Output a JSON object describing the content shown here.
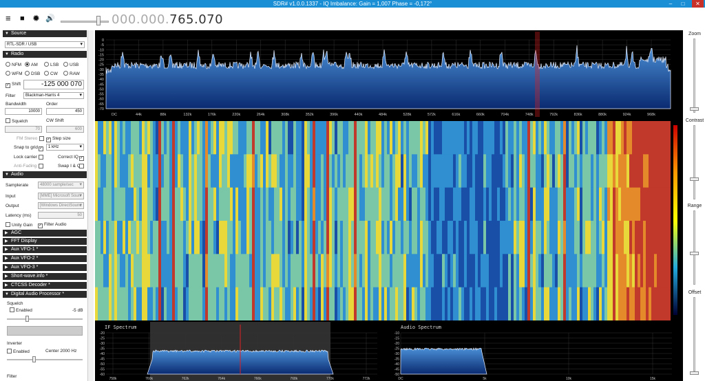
{
  "window": {
    "title": "SDR# v1.0.0.1337 - IQ Imbalance: Gain = 1,007 Phase = -0,172°",
    "minimize": "–",
    "maximize": "□",
    "close": "✕"
  },
  "toolbar": {
    "menu_icon": "≡",
    "stop_icon": "■",
    "gear_icon": "✹",
    "speaker_icon": "🔊",
    "freq_dim": "000.000.",
    "freq_bright": "765.070"
  },
  "source": {
    "header": "Source",
    "device": "RTL-SDR / USB"
  },
  "radio": {
    "header": "Radio",
    "modes_row1": [
      "NFM",
      "AM",
      "LSB",
      "USB"
    ],
    "modes_row2": [
      "WFM",
      "DSB",
      "CW",
      "RAW"
    ],
    "selected_mode": "AM",
    "shift_label": "Shift",
    "shift_value": "-125 000 070",
    "filter_label": "Filter",
    "filter_value": "Blackman-Harris 4",
    "bandwidth_label": "Bandwidth",
    "bandwidth_value": "10000",
    "order_label": "Order",
    "order_value": "450",
    "squelch_label": "Squelch",
    "cw_shift_label": "CW Shift",
    "squelch_value": "70",
    "cw_shift_value": "600",
    "fm_stereo_label": "FM Stereo",
    "step_size_label": "Step size",
    "snap_label": "Snap to grid",
    "snap_value": "1 kHz",
    "lock_carrier_label": "Lock carrier",
    "correct_iq_label": "Correct IQ",
    "anti_fading_label": "Anti-Fading",
    "swap_iq_label": "Swap I & Q"
  },
  "audio": {
    "header": "Audio",
    "samplerate_label": "Samplerate",
    "samplerate_value": "48000 sample/sec",
    "input_label": "Input",
    "input_value": "[MME] Microsoft Soun",
    "output_label": "Output",
    "output_value": "[Windows DirectSounc",
    "latency_label": "Latency (ms)",
    "latency_value": "50",
    "unity_gain_label": "Unity Gain",
    "filter_audio_label": "Filter Audio"
  },
  "collapsed_sections": [
    "AGC",
    "FFT Display",
    "Aux VFO-1 *",
    "Aux VFO-2 *",
    "Aux VFO-3 *",
    "Short-wave.info *",
    "CTCSS Decoder *"
  ],
  "dap": {
    "header": "Digital Audio Processor *",
    "squelch_label": "Squelch",
    "enabled_label": "Enabled",
    "squelch_db": "-5 dB",
    "inverter_label": "Inverter",
    "inv_enabled_label": "Enabled",
    "center_label": "Center",
    "center_value": "2000 Hz",
    "filter_label": "Filter"
  },
  "spectrum": {
    "y_ticks": [
      "0",
      "-5",
      "-10",
      "-15",
      "-20",
      "-25",
      "-30",
      "-35",
      "-40",
      "-45",
      "-50",
      "-55",
      "-60",
      "-65",
      "-70"
    ],
    "x_ticks": [
      "DC",
      "44k",
      "88k",
      "132k",
      "176k",
      "220k",
      "264k",
      "308k",
      "352k",
      "396k",
      "440k",
      "484k",
      "528k",
      "572k",
      "616k",
      "660k",
      "704k",
      "748k",
      "792k",
      "836k",
      "880k",
      "924k",
      "968k"
    ]
  },
  "if_spectrum": {
    "title": "IF Spectrum",
    "y_ticks": [
      "-20",
      "-25",
      "-30",
      "-35",
      "-40",
      "-45",
      "-50",
      "-55",
      "-60"
    ],
    "x_ticks": [
      "758k",
      "760k",
      "762k",
      "764k",
      "766k",
      "768k",
      "770k",
      "772k"
    ]
  },
  "audio_spectrum": {
    "title": "Audio Spectrum",
    "y_ticks": [
      "-10",
      "-15",
      "-20",
      "-25",
      "-30",
      "-35",
      "-40",
      "-45",
      "-50"
    ],
    "x_ticks": [
      "DC",
      "5k",
      "10k",
      "15k"
    ]
  },
  "side_sliders": {
    "zoom": "Zoom",
    "contrast": "Contrast",
    "range": "Range",
    "offset": "Offset"
  },
  "colors": {
    "titlebar": "#1a8fd6",
    "section": "#2b2b2b",
    "spectrum_fill": "#1f5ea8",
    "marker": "#e02020"
  }
}
